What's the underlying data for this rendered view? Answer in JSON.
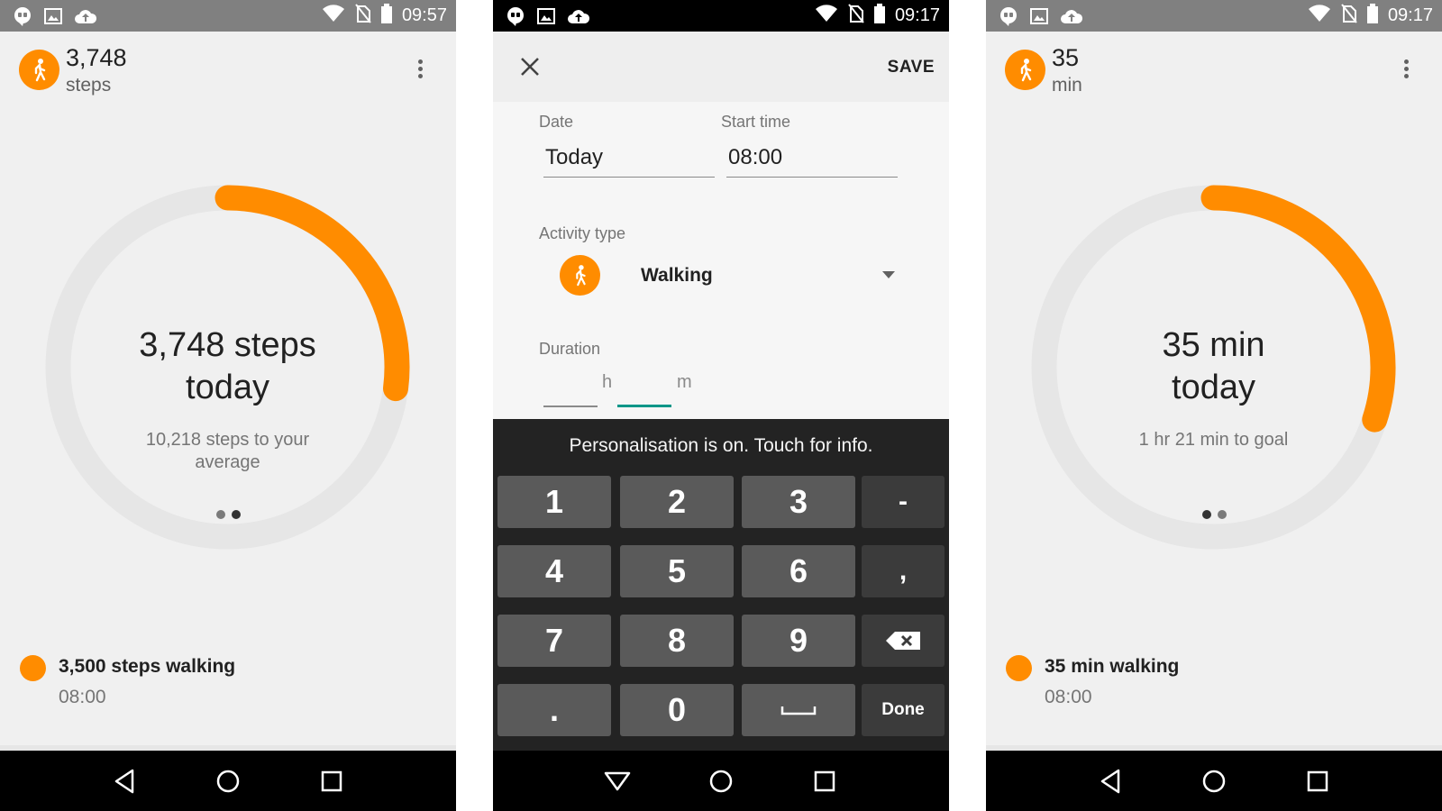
{
  "colors": {
    "accent": "#ff8c00",
    "statusbar": "#808080",
    "statusbar_dark": "#000000",
    "ring_track": "#e6e6e6",
    "teal_focus": "#009688"
  },
  "screen_left": {
    "status_time": "09:57",
    "header_value": "3,748",
    "header_unit": "steps",
    "goal_progress": 0.27,
    "big_line1": "3,748 steps",
    "big_line2": "today",
    "sub_line1": "10,218 steps to your",
    "sub_line2": "average",
    "active_page": 1,
    "entry_title": "3,500 steps walking",
    "entry_time": "08:00",
    "icons": [
      "hangouts-icon",
      "image-icon",
      "cloud-upload-icon",
      "wifi-icon",
      "no-sim-icon",
      "battery-icon",
      "walking-icon",
      "overflow-menu-icon"
    ]
  },
  "screen_middle": {
    "status_time": "09:17",
    "save_label": "SAVE",
    "date_label": "Date",
    "date_value": "Today",
    "start_label": "Start time",
    "start_value": "08:00",
    "activity_label": "Activity type",
    "activity_value": "Walking",
    "duration_label": "Duration",
    "hours_unit": "h",
    "minutes_unit": "m",
    "keyboard_banner": "Personalisation is on. Touch for info.",
    "keys": {
      "k1": "1",
      "k2": "2",
      "k3": "3",
      "dash": "-",
      "k4": "4",
      "k5": "5",
      "k6": "6",
      "comma": ",",
      "k7": "7",
      "k8": "8",
      "k9": "9",
      "dot": ".",
      "k0": "0",
      "done": "Done"
    }
  },
  "screen_right": {
    "status_time": "09:17",
    "header_value": "35",
    "header_unit": "min",
    "goal_progress": 0.3,
    "big_line1": "35 min",
    "big_line2": "today",
    "sub_line1": "1 hr 21 min to goal",
    "active_page": 0,
    "entry_title": "35 min walking",
    "entry_time": "08:00"
  }
}
